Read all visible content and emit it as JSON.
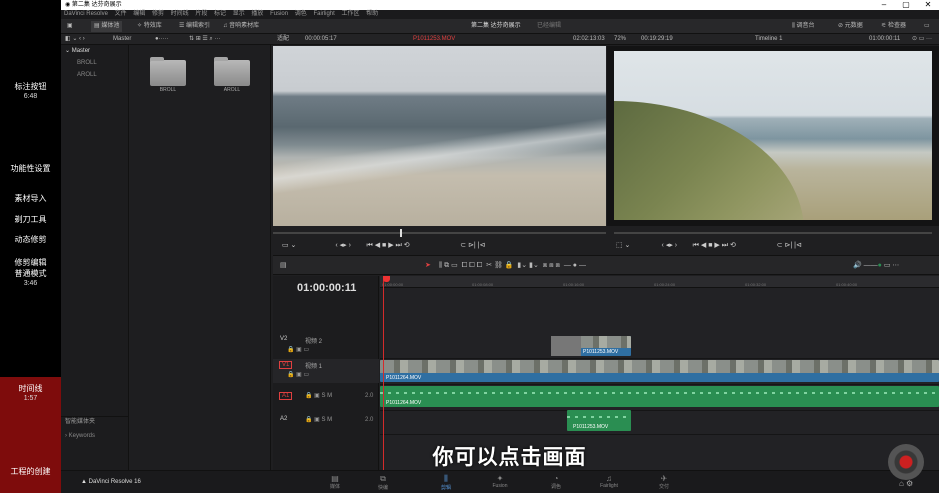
{
  "chapters": [
    {
      "label": "标注按钮",
      "time": "6:48"
    },
    {
      "label": "功能性设置",
      "time": ""
    },
    {
      "label": "素材导入",
      "time": ""
    },
    {
      "label": "剃刀工具",
      "time": ""
    },
    {
      "label": "动态修剪",
      "time": ""
    },
    {
      "label": "修剪编辑",
      "time": ""
    },
    {
      "label": "普通模式",
      "time": "3:46"
    },
    {
      "label": "时间线",
      "time": "1:57"
    },
    {
      "label": "工程的创建",
      "time": ""
    }
  ],
  "window": {
    "title": "第二集 达芬奇展示",
    "controls": [
      "–",
      "▢",
      "✕"
    ]
  },
  "menu": [
    "DaVinci Resolve",
    "文件",
    "编辑",
    "修剪",
    "时间线",
    "片段",
    "标记",
    "显示",
    "播放",
    "Fusion",
    "调色",
    "Fairlight",
    "工作区",
    "帮助"
  ],
  "toolbar": {
    "media_pool": "媒体池",
    "effects": "特效库",
    "edit_index": "编辑索引",
    "sound_library": "音响素材库",
    "project_title": "第二集 达芬奇展示",
    "project_status": "已经编辑",
    "mixer": "调音台",
    "metadata": "元数据",
    "inspector": "检查器"
  },
  "subbar": {
    "pool_path": "Master",
    "fit": "适配",
    "src_timecode_left": "00:00:05:17",
    "src_clip": "P1011253.MOV",
    "src_timecode_right": "02:02:13:03",
    "zoom": "72%",
    "tl_duration": "00:19:29:19",
    "timeline_name": "Timeline 1",
    "tl_timecode": "01:00:00:11"
  },
  "bins": {
    "root": "Master",
    "items": [
      "BROLL",
      "AROLL"
    ],
    "smart_bins": "智能媒体夹",
    "keywords": "Keywords"
  },
  "pool_items": [
    {
      "label": "BROLL"
    },
    {
      "label": "AROLL"
    }
  ],
  "timeline": {
    "timecode": "01:00:00:11",
    "ruler": [
      "01:00:00:00",
      "01:00:08:00",
      "01:00:16:00",
      "01:00:24:00",
      "01:00:32:00",
      "01:00:40:00"
    ],
    "tracks": [
      {
        "id": "V2",
        "name": "视频 2"
      },
      {
        "id": "V1",
        "name": "视频 1"
      },
      {
        "id": "A1",
        "name": "",
        "level": "2.0"
      },
      {
        "id": "A2",
        "name": "",
        "level": "2.0"
      }
    ],
    "clips": {
      "v2": "P1011253.MOV",
      "v1": "P1011264.MOV",
      "a1": "P1011264.MOV",
      "a2": "P1011253.MOV"
    }
  },
  "pages": [
    "媒体",
    "快编",
    "剪辑",
    "Fusion",
    "调色",
    "Fairlight",
    "交付"
  ],
  "active_page": "剪辑",
  "brand": "DaVinci Resolve 16",
  "subtitle": "你可以点击画面",
  "colors": {
    "accent": "#5a9be0",
    "playhead": "#d42b2b",
    "video_clip": "#2f6fa2",
    "audio_clip": "#2a8e52",
    "chapter_active": "#7e0c0c"
  }
}
